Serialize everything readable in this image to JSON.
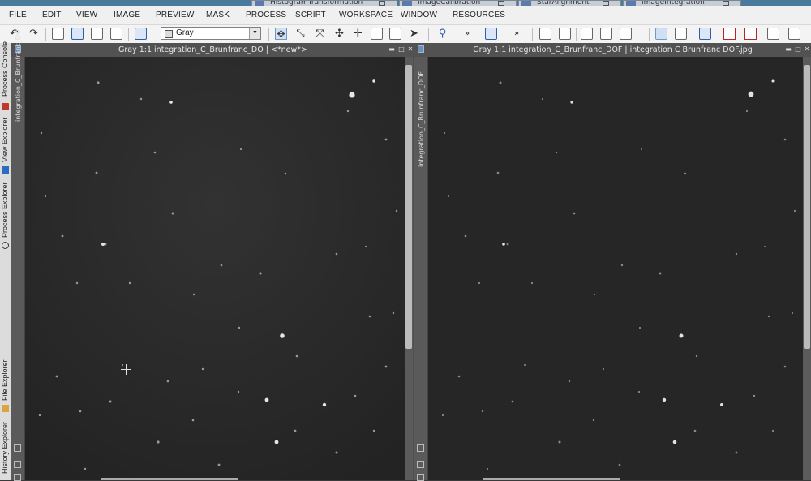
{
  "process_tabs": [
    {
      "label": "HistogramTransformation"
    },
    {
      "label": "ImageCalibration"
    },
    {
      "label": "StarAlignment"
    },
    {
      "label": "ImageIntegration"
    }
  ],
  "menu": [
    "FILE",
    "EDIT",
    "VIEW",
    "IMAGE",
    "PREVIEW",
    "MASK",
    "PROCESS",
    "SCRIPT",
    "WORKSPACE",
    "WINDOW",
    "RESOURCES"
  ],
  "toolbar": {
    "colorspace_value": "Gray",
    "more_label_1": "»",
    "more_label_2": "»"
  },
  "side_tabs": [
    "Process Console",
    "View Explorer",
    "Process Explorer",
    "File Explorer",
    "History Explorer"
  ],
  "windows": [
    {
      "title": "Gray 1:1 integration_C_Brunfranc_DO | <*new*>",
      "identifier": "integration_C_Brunfranc_DO",
      "sky_color": "#2a2a2a"
    },
    {
      "title": "Gray 1:1 integration_C_Brunfranc_DOF | integration C Brunfranc DOF.jpg",
      "identifier": "integration_C_Brunfranc_DOF",
      "sky_color": "#252525"
    }
  ]
}
